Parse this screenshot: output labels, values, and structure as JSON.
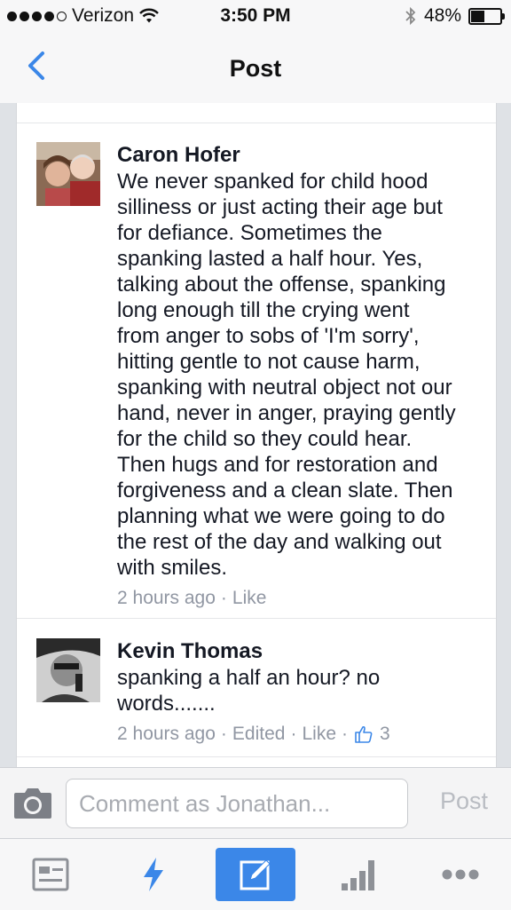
{
  "status_bar": {
    "carrier": "Verizon",
    "time": "3:50 PM",
    "battery": "48%"
  },
  "nav": {
    "title": "Post"
  },
  "comments": [
    {
      "author": "Caron Hofer",
      "text": "We never spanked for child hood\nsilliness or just acting their age but\nfor defiance.  Sometimes the\nspanking lasted a half hour.  Yes,\ntalking about the offense, spanking\nlong enough till the crying went\nfrom anger to sobs of 'I'm sorry',\nhitting gentle to not cause harm,\nspanking with neutral object not our\nhand, never in anger, praying gently\nfor the child so they could hear.\nThen hugs and for restoration and\nforgiveness and a clean slate.  Then\nplanning what we were going to do\nthe rest of the day and walking out\nwith smiles.",
      "time": "2 hours ago",
      "like": "Like"
    },
    {
      "author": "Kevin Thomas",
      "text": "spanking a half an hour?  no\nwords.......",
      "time": "2 hours ago",
      "edited": "Edited",
      "like": "Like",
      "like_count": "3"
    }
  ],
  "composer": {
    "placeholder": "Comment as Jonathan...",
    "post_label": "Post"
  },
  "tabs": [
    "news-feed-icon",
    "lightning-icon",
    "compose-icon",
    "stats-icon",
    "more-icon"
  ],
  "colors": {
    "accent": "#3b87e8",
    "meta": "#9197a3"
  }
}
